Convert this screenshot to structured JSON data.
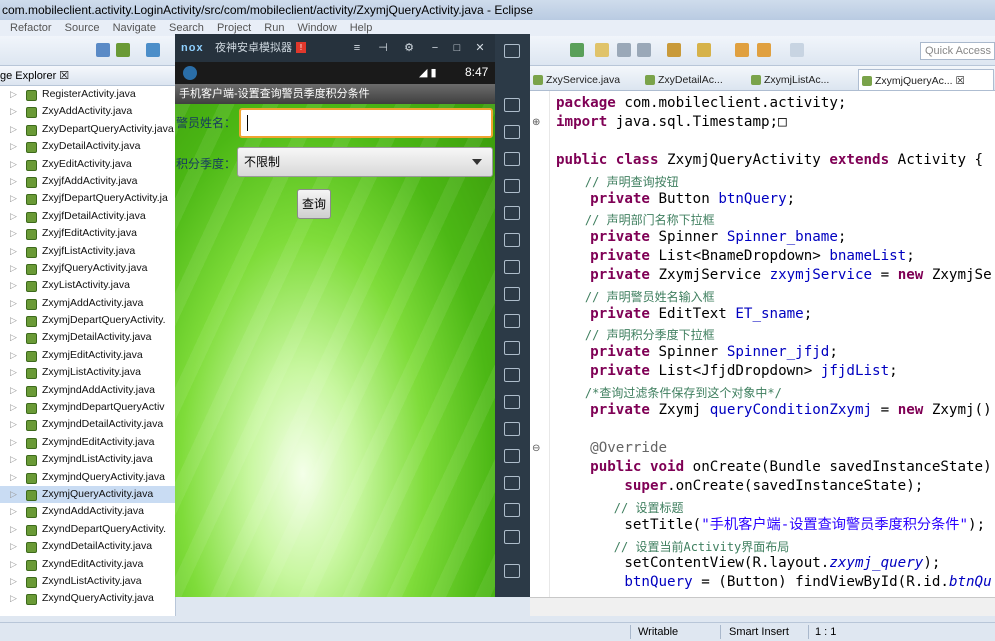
{
  "window": {
    "title": "com.mobileclient.activity.LoginActivity/src/com/mobileclient/activity/ZxymjQueryActivity.java - Eclipse"
  },
  "menu": [
    "Refactor",
    "Source",
    "Navigate",
    "Search",
    "Project",
    "Run",
    "Window",
    "Help"
  ],
  "quick_access": {
    "placeholder": "Quick Access"
  },
  "explorer": {
    "title": "ge Explorer ☒",
    "files": [
      "RegisterActivity.java",
      "ZxyAddActivity.java",
      "ZxyDepartQueryActivity.java",
      "ZxyDetailActivity.java",
      "ZxyEditActivity.java",
      "ZxyjfAddActivity.java",
      "ZxyjfDepartQueryActivity.ja",
      "ZxyjfDetailActivity.java",
      "ZxyjfEditActivity.java",
      "ZxyjfListActivity.java",
      "ZxyjfQueryActivity.java",
      "ZxyListActivity.java",
      "ZxymjAddActivity.java",
      "ZxymjDepartQueryActivity.",
      "ZxymjDetailActivity.java",
      "ZxymjEditActivity.java",
      "ZxymjListActivity.java",
      "ZxymjndAddActivity.java",
      "ZxymjndDepartQueryActiv",
      "ZxymjndDetailActivity.java",
      "ZxymjndEditActivity.java",
      "ZxymjndListActivity.java",
      "ZxymjndQueryActivity.java",
      "ZxymjQueryActivity.java",
      "ZxyndAddActivity.java",
      "ZxyndDepartQueryActivity.",
      "ZxyndDetailActivity.java",
      "ZxyndEditActivity.java",
      "ZxyndListActivity.java",
      "ZxyndQueryActivity.java"
    ],
    "selected_index": 23
  },
  "emulator": {
    "logo": "nox",
    "title": "夜神安卓模拟器",
    "badge": "!",
    "status_time": "8:47",
    "app_title": "手机客户端-设置查询警员季度积分条件",
    "name_label": "警员姓名：",
    "name_value": "",
    "season_label": "积分季度：",
    "season_selected": "不限制",
    "query_button": "查询"
  },
  "editor": {
    "tabs": [
      "ZxyService.java",
      "ZxyDetailAc...",
      "ZxymjListAc...",
      "ZxymjQueryAc... ☒"
    ],
    "active_tab": 3
  },
  "statusbar": {
    "mode": "Writable",
    "insert": "Smart Insert",
    "position": "1 : 1"
  }
}
